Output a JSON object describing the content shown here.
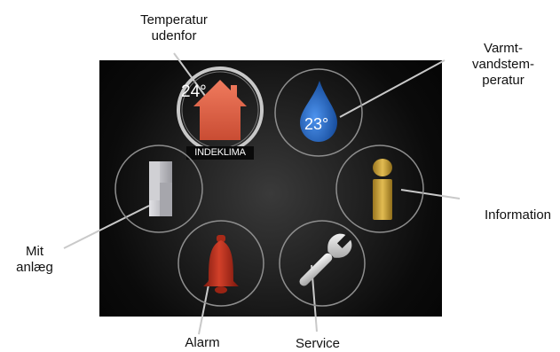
{
  "callouts": {
    "temperature_outdoor": "Temperatur\nudenfor",
    "hot_water_temperature": "Varmt-\nvandstem-\nperatur",
    "information": "Information",
    "my_system": "Mit\nanlæg",
    "alarm": "Alarm",
    "service": "Service"
  },
  "screen": {
    "outdoor_temp": "24°",
    "hot_water_temp": "23°",
    "home_label": "INDEKLIMA"
  },
  "menu_items": [
    {
      "id": "indoor-climate",
      "icon": "house-icon"
    },
    {
      "id": "hot-water",
      "icon": "water-drop-icon"
    },
    {
      "id": "my-system",
      "icon": "system-cabinet-icon"
    },
    {
      "id": "information",
      "icon": "info-icon"
    },
    {
      "id": "alarm",
      "icon": "bell-icon"
    },
    {
      "id": "service",
      "icon": "wrench-icon"
    }
  ],
  "colors": {
    "screen_bg": "#111111",
    "house": "#e8644a",
    "drop": "#2a6fd1",
    "info": "#c8a23a",
    "bell": "#b52d1c",
    "wrench": "#d8d8d8",
    "cabinet": "#b9b9bd"
  }
}
